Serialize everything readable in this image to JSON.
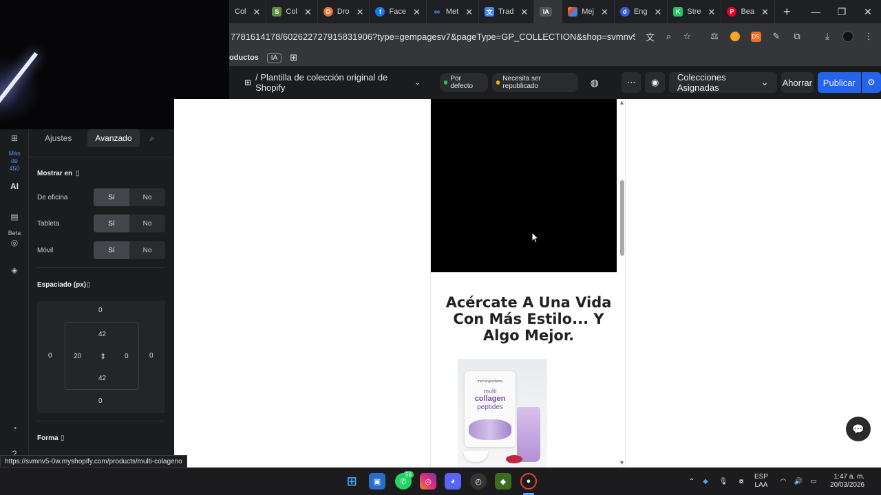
{
  "browser": {
    "tabs": [
      {
        "label": "Col",
        "icon": "doc-icon",
        "color": "#555"
      },
      {
        "label": "Col",
        "icon": "shopify-icon",
        "color": "#5e8e3e"
      },
      {
        "label": "Dro",
        "icon": "dropi-icon",
        "color": "#e8743b"
      },
      {
        "label": "Face",
        "icon": "facebook-icon",
        "color": "#1877f2"
      },
      {
        "label": "Met",
        "icon": "meta-icon",
        "color": "#0668e1"
      },
      {
        "label": "Trad",
        "icon": "translate-icon",
        "color": "#4285f4"
      },
      {
        "label": "IA",
        "icon": "ia-icon",
        "color": "#555",
        "active": true
      },
      {
        "label": "Mej",
        "icon": "colorful-icon",
        "color": "#f4b400"
      },
      {
        "label": "Eng",
        "icon": "d-icon",
        "color": "#3b5bdb"
      },
      {
        "label": "Stre",
        "icon": "k-icon",
        "color": "#22c55e"
      },
      {
        "label": "Bea",
        "icon": "pinterest-icon",
        "color": "#e60023"
      }
    ],
    "url": "7781614178/602622727915831906?type=gempagesv7&pageType=GP_COLLECTION&shop=svmnv5-0w.myshopi...",
    "bookmarks": {
      "productos": "oductos",
      "ia": "IA"
    }
  },
  "app_header": {
    "breadcrumb": "/ Plantilla de colección original de Shopify",
    "badge_default": "Por defecto",
    "badge_republish": "Necesita ser republicado",
    "assigned": "Colecciones Asignadas",
    "save": "Ahorrar",
    "publish": "Publicar",
    "colors": {
      "default_dot": "#22c55e",
      "republish_dot": "#f5b400",
      "publish_bg": "#2563eb"
    }
  },
  "rail": {
    "more_label": "Más de 450",
    "ai_label": "AI",
    "beta_label": "Beta"
  },
  "panel": {
    "tab_settings": "Ajustes",
    "tab_advanced": "Avanzado",
    "show_on": "Mostrar en",
    "devices": [
      {
        "label": "De oficina",
        "yes": "Sí",
        "no": "No"
      },
      {
        "label": "Tableta",
        "yes": "Sí",
        "no": "No"
      },
      {
        "label": "Móvil",
        "yes": "Sí",
        "no": "No"
      }
    ],
    "spacing_title": "Espaciado (px)",
    "spacing": {
      "margin_top": "0",
      "margin_bottom": "0",
      "margin_left": "0",
      "margin_right": "0",
      "padding_top": "42",
      "padding_bottom": "42",
      "padding_left": "20",
      "padding_right": "0"
    },
    "shape_title": "Forma"
  },
  "canvas": {
    "heading": "Acércate A Una Vida Con Más Estilo... Y Algo Mejor.",
    "product_brand": "microingredients",
    "product_line1": "multi",
    "product_line2": "collagen",
    "product_line3": "peptides"
  },
  "status_url": "https://svmnv5-0w.myshopify.com/products/multi-colageno",
  "taskbar": {
    "whatsapp_badge": "56",
    "lang": "ESP",
    "lang2": "LAA",
    "time": "1:47 a. m.",
    "date": "20/03/2026"
  }
}
